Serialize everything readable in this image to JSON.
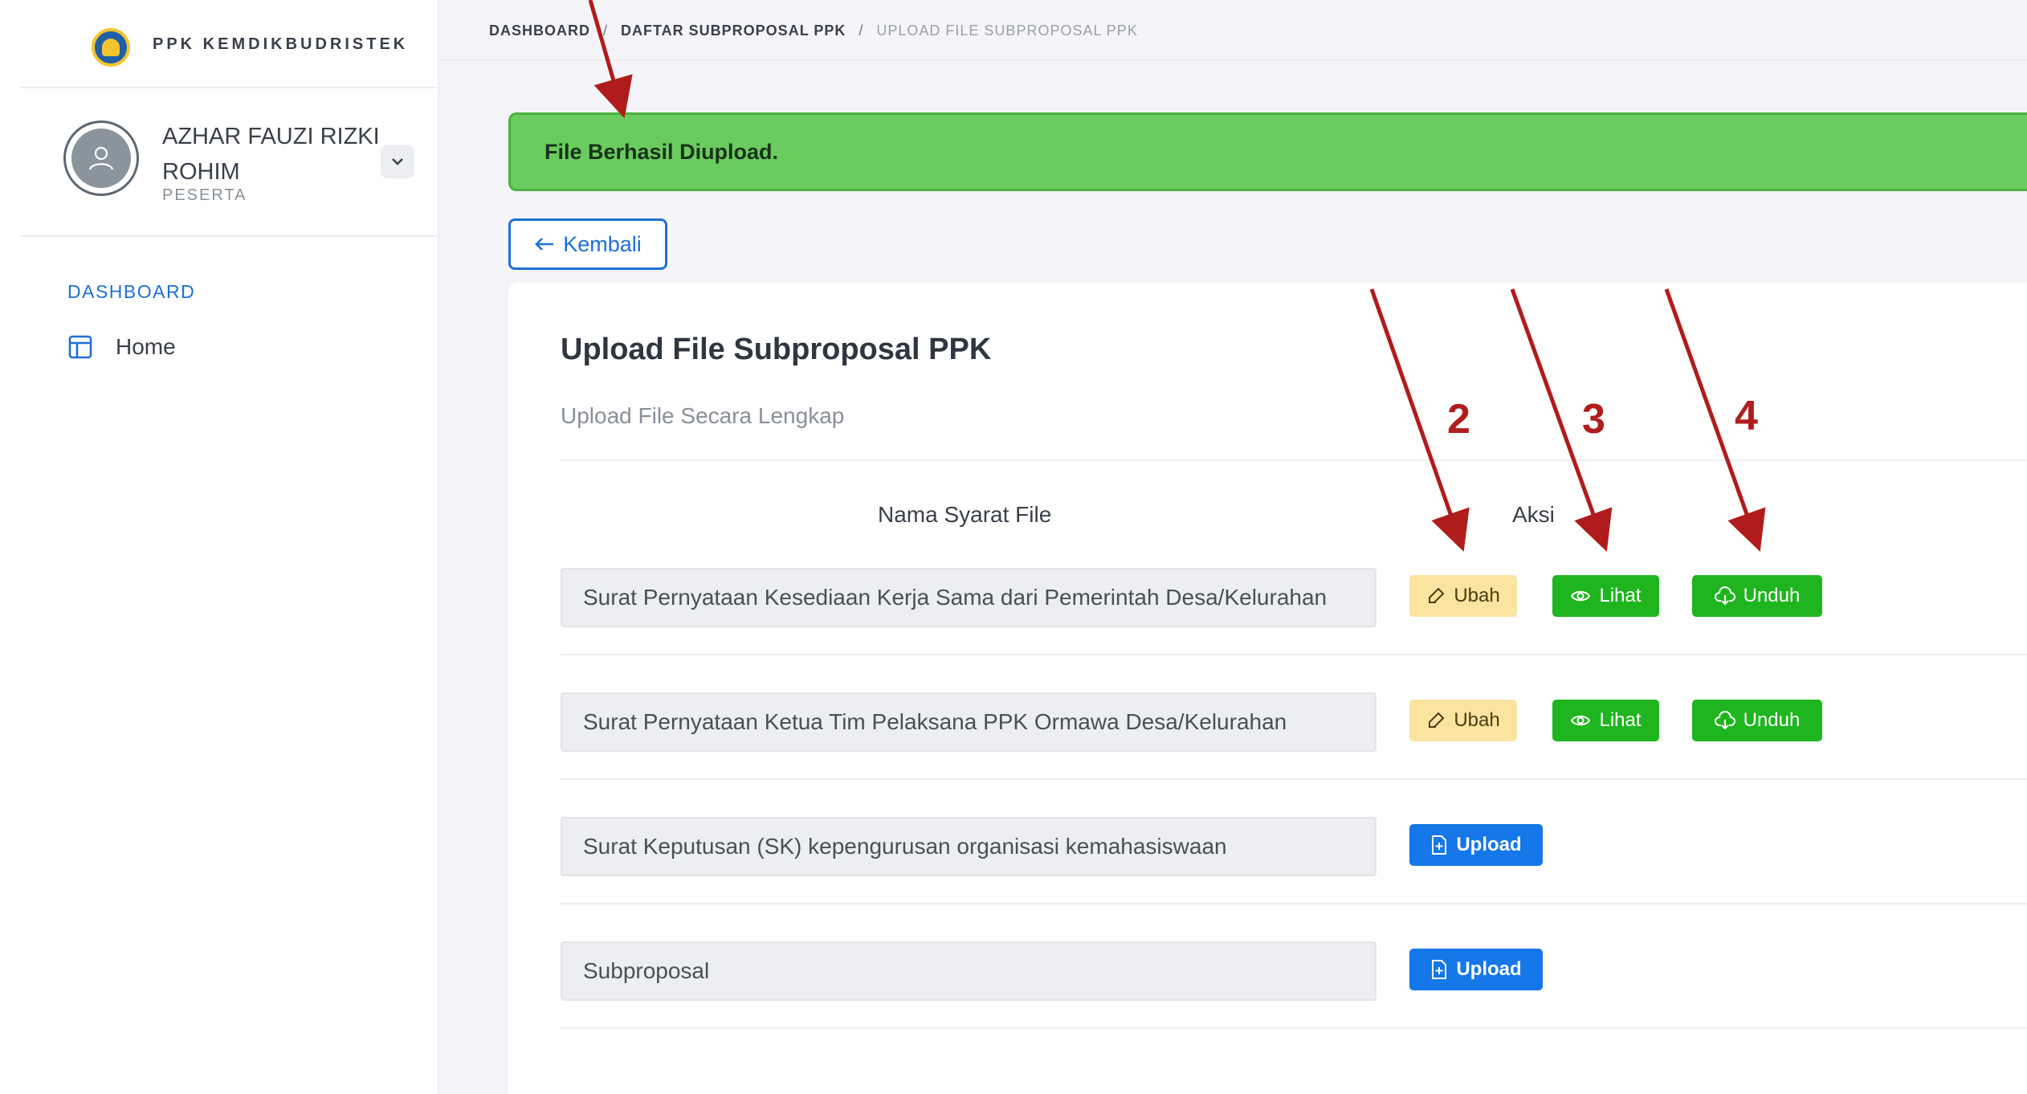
{
  "brand": {
    "name": "PPK KEMDIKBUDRISTEK"
  },
  "user": {
    "name": "AZHAR FAUZI RIZKI ROHIM",
    "role": "PESERTA"
  },
  "menu": {
    "header": "DASHBOARD",
    "items": [
      {
        "label": "Home",
        "icon": "layout-icon"
      }
    ]
  },
  "breadcrumb": {
    "items": [
      "DASHBOARD",
      "DAFTAR SUBPROPOSAL PPK",
      "UPLOAD FILE SUBPROPOSAL PPK"
    ],
    "separator": "/"
  },
  "alert": {
    "message": "File Berhasil Diupload."
  },
  "back": {
    "label": "Kembali"
  },
  "card": {
    "title": "Upload File Subproposal PPK",
    "subtitle": "Upload File Secara Lengkap",
    "columns": {
      "name": "Nama Syarat File",
      "action": "Aksi"
    },
    "rows": [
      {
        "name": "Surat Pernyataan Kesediaan Kerja Sama dari Pemerintah Desa/Kelurahan",
        "uploaded": true
      },
      {
        "name": "Surat Pernyataan Ketua Tim Pelaksana PPK Ormawa Desa/Kelurahan",
        "uploaded": true
      },
      {
        "name": "Surat Keputusan (SK) kepengurusan organisasi kemahasiswaan",
        "uploaded": false
      },
      {
        "name": "Subproposal",
        "uploaded": false
      }
    ]
  },
  "buttons": {
    "ubah": "Ubah",
    "lihat": "Lihat",
    "unduh": "Unduh",
    "upload": "Upload"
  },
  "annotations": {
    "a2": "2",
    "a3": "3",
    "a4": "4"
  },
  "colors": {
    "primary": "#1577e8",
    "success": "#1fb51f",
    "warning": "#fbe3a0",
    "alert": "#6acc5e",
    "annotation": "#b01c1c"
  }
}
